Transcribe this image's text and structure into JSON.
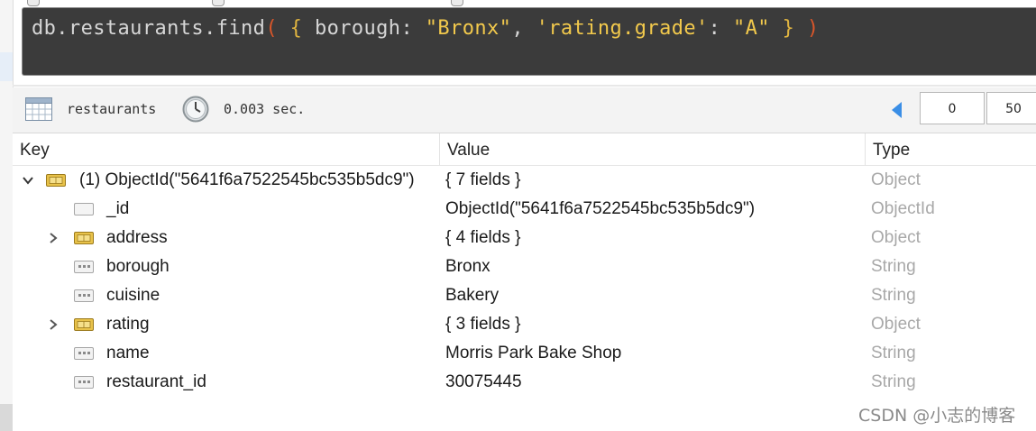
{
  "query": {
    "db": "db",
    "dot1": ".",
    "collection": "restaurants",
    "dot2": ".",
    "method": "find",
    "paren_open": "(",
    "brace_open": "{",
    "field1": "borough",
    "colon1": ":",
    "value1": "\"Bronx\"",
    "comma": ",",
    "field2": "'rating.grade'",
    "colon2": ":",
    "value2": "\"A\"",
    "brace_close": "}",
    "paren_close": ")"
  },
  "toolbar": {
    "collection": "restaurants",
    "elapsed": "0.003 sec.",
    "skip": "0",
    "limit": "50"
  },
  "table": {
    "headers": {
      "key": "Key",
      "value": "Value",
      "type": "Type"
    },
    "root": {
      "key": "(1) ObjectId(\"5641f6a7522545bc535b5dc9\")",
      "value": "{ 7 fields }",
      "type": "Object",
      "icon": "object-icon"
    },
    "fields": [
      {
        "key": "_id",
        "value": "ObjectId(\"5641f6a7522545bc535b5dc9\")",
        "type": "ObjectId",
        "icon": "objectid-icon"
      },
      {
        "key": "address",
        "value": "{ 4 fields }",
        "type": "Object",
        "icon": "object-icon"
      },
      {
        "key": "borough",
        "value": "Bronx",
        "type": "String",
        "icon": "string-icon"
      },
      {
        "key": "cuisine",
        "value": "Bakery",
        "type": "String",
        "icon": "string-icon"
      },
      {
        "key": "rating",
        "value": "{ 3 fields }",
        "type": "Object",
        "icon": "object-icon"
      },
      {
        "key": "name",
        "value": "Morris Park Bake Shop",
        "type": "String",
        "icon": "string-icon"
      },
      {
        "key": "restaurant_id",
        "value": "30075445",
        "type": "String",
        "icon": "string-icon"
      }
    ]
  },
  "watermark": "CSDN @小志的博客"
}
